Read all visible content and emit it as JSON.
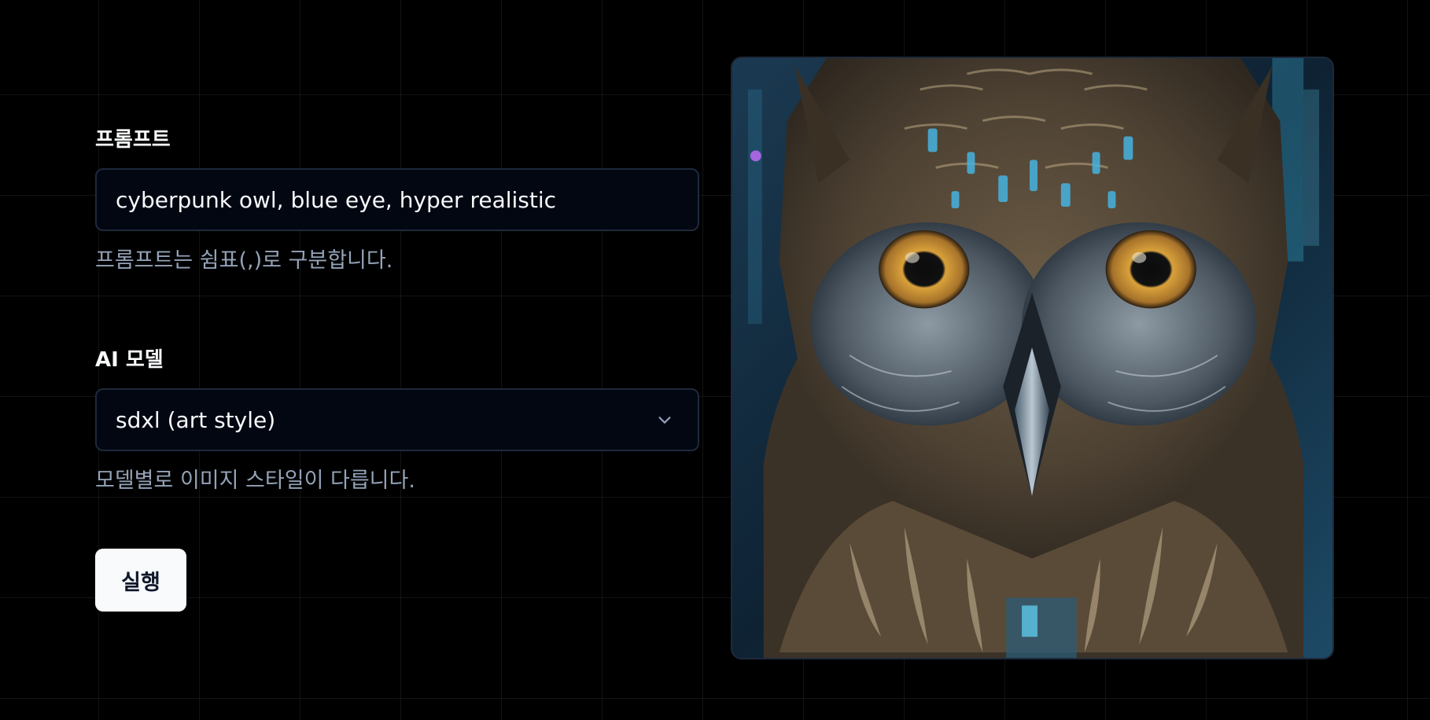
{
  "prompt": {
    "label": "프롬프트",
    "value": "cyberpunk owl, blue eye, hyper realistic",
    "helper": "프롬프트는 쉼표(,)로 구분합니다."
  },
  "model": {
    "label": "AI 모델",
    "selected": "sdxl (art style)",
    "helper": "모델별로 이미지 스타일이 다릅니다."
  },
  "run_button": {
    "label": "실행"
  },
  "icons": {
    "select_chevron": "chevron-down-icon"
  },
  "colors": {
    "background": "#000000",
    "input_background": "#030712",
    "input_border": "#1e293b",
    "label_text": "#f8fafc",
    "helper_text": "#94a3b8",
    "button_background": "#f8fafc",
    "button_text": "#0f172a"
  }
}
